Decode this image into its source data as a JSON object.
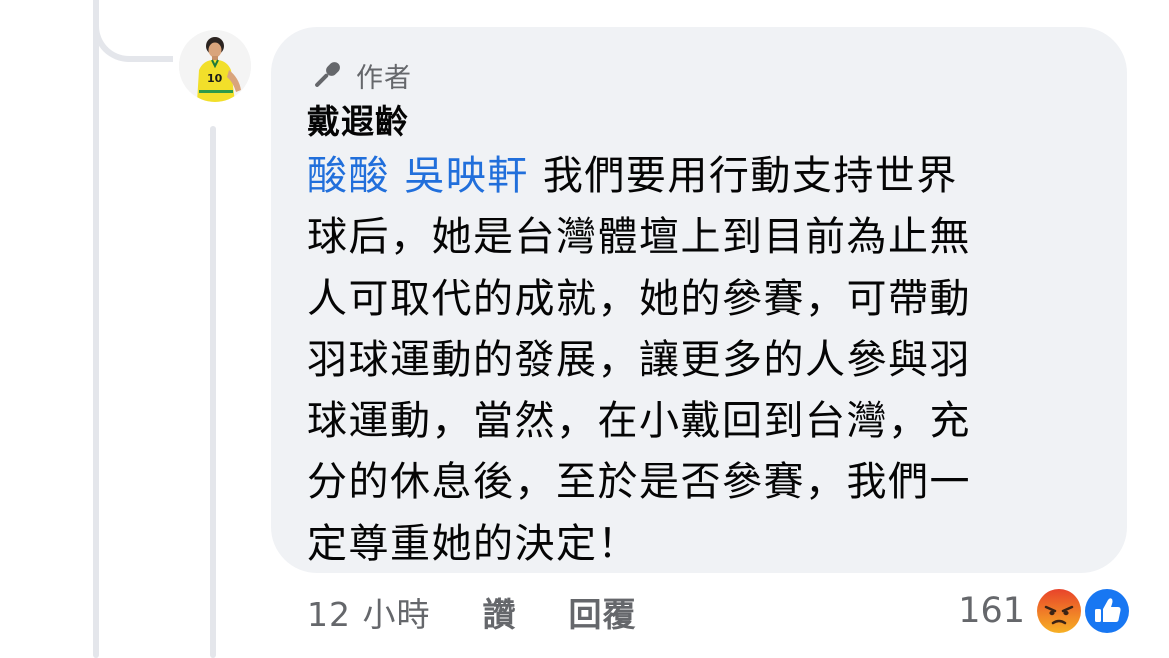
{
  "comment": {
    "author_badge": "作者",
    "author_name": "戴遐齡",
    "mentions": [
      "酸酸",
      "吳映軒"
    ],
    "body_lines": [
      " 我們要用行動支持世界",
      "球后，她是台灣體壇上到目前為止無",
      "人可取代的成就，她的參賽，可帶動",
      "羽球運動的發展，讓更多的人參與羽",
      "球運動，當然，在小戴回到台灣，充",
      "分的休息後，至於是否參賽，我們一",
      "定尊重她的決定！"
    ],
    "avatar_jersey_number": "10"
  },
  "actions": {
    "timestamp": "12 小時",
    "like_label": "讚",
    "reply_label": "回覆"
  },
  "reactions": {
    "count": "161",
    "icons": [
      "angry-reaction-icon",
      "like-reaction-icon"
    ]
  },
  "colors": {
    "bubble": "#f0f2f5",
    "mention": "#216fdb",
    "secondary_text": "#65676b",
    "primary_text": "#050505",
    "like_blue": "#1877f2",
    "angry_orange": "#f0602a"
  }
}
